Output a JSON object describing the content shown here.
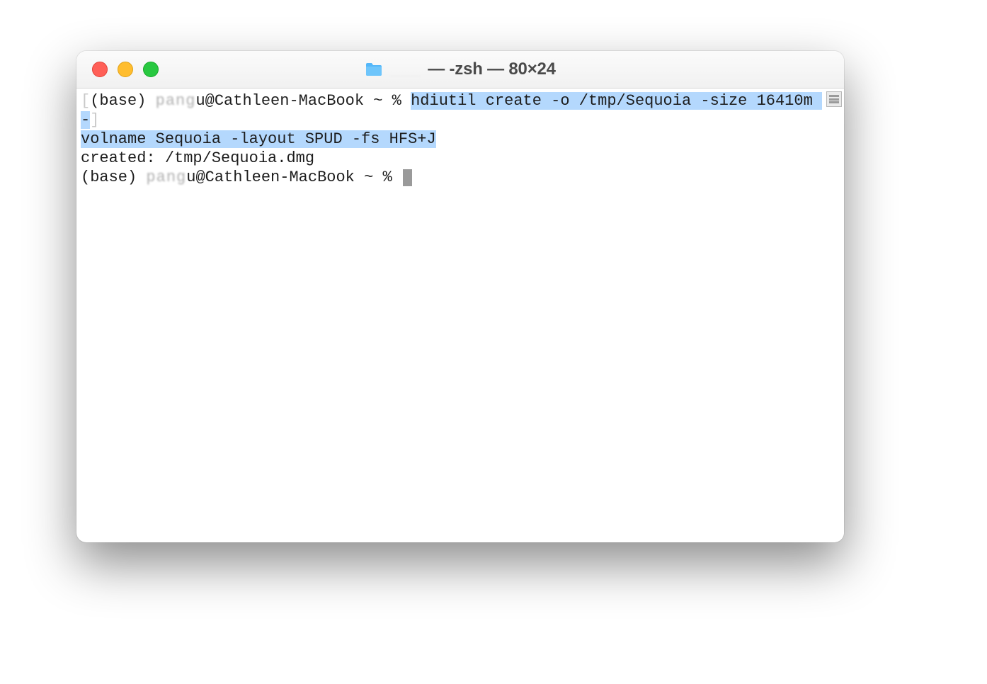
{
  "window": {
    "title_suffix": "— -zsh — 80×24",
    "title_folder_name_hidden": true
  },
  "terminal": {
    "lines": {
      "l1_prompt_open": "(base) ",
      "l1_user_hidden": "u",
      "l1_prompt_host": "@Cathleen-MacBook ~ % ",
      "l1_cmd_highlight": "hdiutil create -o /tmp/Sequoia -size 16410m -",
      "l2_cmd_highlight": "volname Sequoia -layout SPUD -fs HFS+J",
      "l3_output": "created: /tmp/Sequoia.dmg",
      "l4_prompt_open": "(base) ",
      "l4_user_hidden": "u",
      "l4_prompt_host": "@Cathleen-MacBook ~ % "
    }
  }
}
